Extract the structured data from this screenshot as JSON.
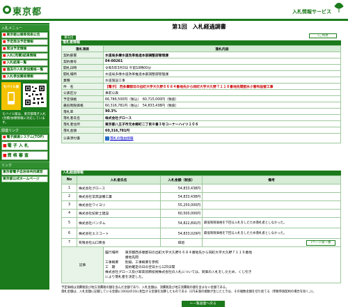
{
  "header": {
    "org_name": "東京都",
    "service_name": "入札情報サービス"
  },
  "sidebar": {
    "menu_head": "入札メニュー",
    "items": [
      {
        "label": "東京都公報等発表公告"
      },
      {
        "label": "予定発注予定情報"
      },
      {
        "label": "発注予定情報"
      },
      {
        "label": "入札(見積)結果情報"
      },
      {
        "label": "入札結果一覧"
      },
      {
        "label": "過去の入札参加資格一覧"
      },
      {
        "label": "入札参加資格情報"
      }
    ],
    "mobile_label": "モバイル版",
    "mobile_note": "モバイル版は、東京都電子入札(見積)依頼情報に対応しています。",
    "link_head": "関連リンク",
    "links": [
      {
        "label": "電子調達システム(TOP)"
      },
      {
        "label": "電 子 入 札"
      },
      {
        "label": "資 格 審 査"
      }
    ],
    "link_head2": "リンク",
    "links2": [
      {
        "label": "東京都電子自治体共同運営"
      },
      {
        "label": "東京都公式ホームページ"
      }
    ]
  },
  "main": {
    "title": "第1回　入札経過調書",
    "back_label": "(ご利用",
    "round_label": "第1回",
    "info_section": "落札者情報",
    "info_header": [
      "落札項目",
      "落札内容"
    ],
    "info_rows": [
      {
        "label": "契約部署",
        "value": "水道局多摩水道改革推進本部調整部管理課"
      },
      {
        "label": "契約番号",
        "value": "04-00261"
      },
      {
        "label": "開札日時",
        "value": "令和5年3月3日 午前10時00分"
      },
      {
        "label": "開札場所",
        "value": "水道局多摩水道改革推進本部調整部管理課"
      },
      {
        "label": "業種",
        "value": "水道施設工事"
      },
      {
        "label": "件　名",
        "value": "【電子】 西多摩郡日の出町大字大久野６６８４番地先から同町大字大久野７１１６番地先間配水小管布設替工事"
      },
      {
        "label": "公表区分",
        "value": "事前公表"
      },
      {
        "label": "予定価格",
        "value": "66,786,500円（税込）　60,715,000円（税抜）"
      },
      {
        "label": "最低制限価格",
        "value": "60,316,781円（税込）　54,833,438円（税抜）"
      },
      {
        "label": "落札率",
        "value": "90.3%"
      },
      {
        "label": "落札者氏名",
        "value": "株式会社グロース"
      },
      {
        "label": "落札者住所",
        "value": "東京都八王子市元本郷町二丁目８番３号コーナーハイツ１０６"
      },
      {
        "label": "落札金額",
        "value": "60,316,781円"
      },
      {
        "label": "公表添付書",
        "value": "落札の理由情報"
      }
    ],
    "bid_section": "入札経過情報",
    "bid_header": [
      "No",
      "入札者氏名",
      "入札金額（税抜）",
      "備考"
    ],
    "bid_rows": [
      {
        "no": "1",
        "name": "株式会社グロース",
        "amount": "54,833,438円",
        "note": ""
      },
      {
        "no": "2",
        "name": "株式会社常高設備工業",
        "amount": "54,833,438円",
        "note": ""
      },
      {
        "no": "3",
        "name": "株式会社ワイヨリ",
        "amount": "55,250,000円",
        "note": ""
      },
      {
        "no": "4",
        "name": "株式会社紀新土建設",
        "amount": "60,500,000円",
        "note": ""
      },
      {
        "no": "5",
        "name": "株式会社バンタム",
        "amount": "54,822,891円",
        "note": "最低制限価格を下回る入札をしたため落札者としなかった。"
      },
      {
        "no": "6",
        "name": "株式会社エスコート",
        "amount": "54,833,029円",
        "note": "最低制限価格を下回る入札をしたため落札者としなかった。"
      },
      {
        "no": "7",
        "name": "有限会社山口商会",
        "amount": "辞退",
        "note": ""
      }
    ],
    "notes_button": "(ページ第一番",
    "remarks_label": "記事",
    "remarks_lines": [
      "履行場所　　東京都西多摩郡日の出町大字大久野６６８４番地先から同町大字大久野７１１６番地",
      "　　　　　　番地先間",
      "工事概要　　別紙、工事概要を参照",
      "工　期　　　契約確定の日の翌日から125日間",
      "株式会社グロース及び翠高装飾技術株式会社の入札については、同価の入札をしたため、くじ引き",
      "により落札者を決定した。"
    ],
    "footnotes": [
      "予定価格は消費税及び地方消費税の額を含んだ金額であり、入札金額は、消費税及び地方消費税の額を含まない金額である。",
      "落札金額は、入札金額に記載している金額に100分の10に相当する金額を加算したものである（1円未満の端数が生じたときは、その端数金額を切り捨てる（単数単価契約の場合を除く。)）。"
    ],
    "bottom_button": "←一覧画面へ戻る"
  }
}
